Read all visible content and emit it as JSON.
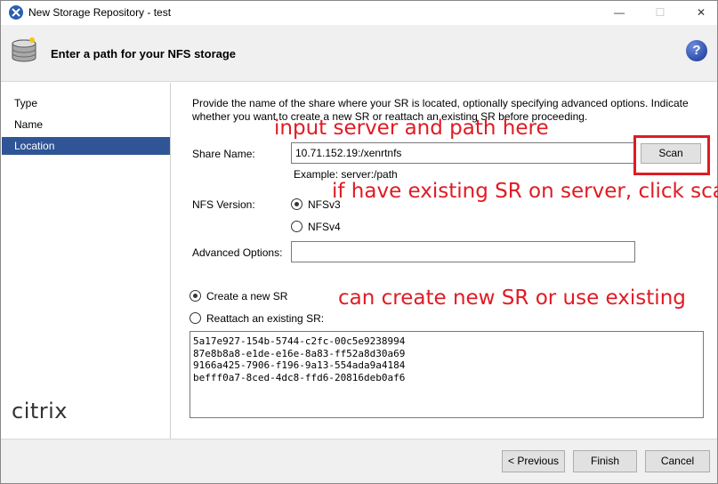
{
  "window": {
    "title": "New Storage Repository - test",
    "min_glyph": "—",
    "max_glyph": "☐",
    "close_glyph": "✕"
  },
  "header": {
    "title": "Enter a path for your NFS storage",
    "help_glyph": "?"
  },
  "nav": {
    "items": [
      {
        "label": "Type",
        "active": false
      },
      {
        "label": "Name",
        "active": false
      },
      {
        "label": "Location",
        "active": true
      }
    ],
    "logo_text": "citrix"
  },
  "main": {
    "description": "Provide the name of the share where your SR is located, optionally specifying advanced options. Indicate whether you want to create a new SR or reattach an existing SR before proceeding.",
    "share_name_label": "Share Name:",
    "share_name_value": "10.71.152.19:/xenrtnfs",
    "scan_label": "Scan",
    "example_text": "Example: server:/path",
    "nfs_version_label": "NFS Version:",
    "nfs_options": [
      {
        "label": "NFSv3",
        "checked": true
      },
      {
        "label": "NFSv4",
        "checked": false
      }
    ],
    "advanced_label": "Advanced Options:",
    "advanced_value": "",
    "create_new_label": "Create a new SR",
    "create_new_checked": true,
    "reattach_label": "Reattach an existing SR:",
    "reattach_checked": false,
    "existing_srs": [
      "5a17e927-154b-5744-c2fc-00c5e9238994",
      "87e8b8a8-e1de-e16e-8a83-ff52a8d30a69",
      "9166a425-7906-f196-9a13-554ada9a4184",
      "befff0a7-8ced-4dc8-ffd6-20816deb0af6"
    ]
  },
  "annotations": {
    "input_hint": "input server and path here",
    "scan_hint": "if have existing SR on server, click scan",
    "create_hint": "can create new SR or use existing"
  },
  "footer": {
    "previous_label": "< Previous",
    "finish_label": "Finish",
    "cancel_label": "Cancel"
  },
  "colors": {
    "nav_active": "#2f5597",
    "annotation_red": "#e01b24",
    "header_bg": "#f0f0f0"
  }
}
